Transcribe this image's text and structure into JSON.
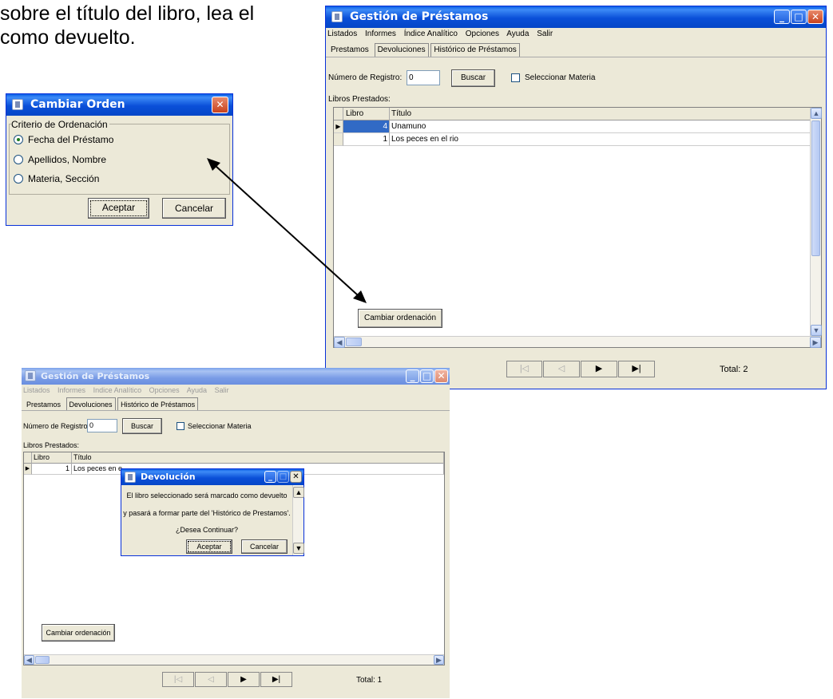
{
  "doc": {
    "line1": "sobre el título del libro, lea el",
    "line2": "como devuelto."
  },
  "main_window": {
    "title": "Gestión de Préstamos",
    "menu": [
      "Listados",
      "Informes",
      "Índice Analítico",
      "Opciones",
      "Ayuda",
      "Salir"
    ],
    "tabs": [
      "Prestamos",
      "Devoluciones",
      "Histórico de Préstamos"
    ],
    "active_tab": "Devoluciones",
    "registro_label": "Número de Registro:",
    "registro_value": "0",
    "buscar_label": "Buscar",
    "materia_label": "Seleccionar Materia",
    "libros_label": "Libros Prestados:",
    "columns": [
      "Libro",
      "Título"
    ],
    "rows": [
      {
        "libro": "4",
        "titulo": "Unamuno"
      },
      {
        "libro": "1",
        "titulo": "Los peces en el rio"
      }
    ],
    "cambiar_label": "Cambiar ordenación",
    "nav": [
      "|◁",
      "◁",
      "▶",
      "▶|"
    ],
    "total": "Total: 2"
  },
  "order_dialog": {
    "title": "Cambiar Orden",
    "group_label": "Criterio de Ordenación",
    "options": [
      "Fecha del Préstamo",
      "Apellidos, Nombre",
      "Materia, Sección"
    ],
    "selected": "Fecha del Préstamo",
    "accept": "Aceptar",
    "cancel": "Cancelar"
  },
  "second_window": {
    "title": "Gestión de Préstamos",
    "menu": [
      "Listados",
      "Informes",
      "Indice Analítico",
      "Opciones",
      "Ayuda",
      "Salir"
    ],
    "tabs": [
      "Prestamos",
      "Devoluciones",
      "Histórico de Préstamos"
    ],
    "registro_label": "Número de Registro:",
    "registro_value": "0",
    "buscar_label": "Buscar",
    "materia_label": "Seleccionar Materia",
    "libros_label": "Libros Prestados:",
    "columns": [
      "Libro",
      "Título"
    ],
    "rows": [
      {
        "libro": "1",
        "titulo": "Los peces en e"
      }
    ],
    "cambiar_label": "Cambiar ordenación",
    "nav": [
      "|◁",
      "◁",
      "▶",
      "▶|"
    ],
    "total": "Total: 1"
  },
  "return_dialog": {
    "title": "Devolución",
    "line1": "El libro seleccionado será marcado como devuelto",
    "line2": "y pasará a formar parte del 'Histórico de Prestamos'.",
    "line3": "¿Desea Continuar?",
    "accept": "Aceptar",
    "cancel": "Cancelar"
  },
  "colors": {
    "title_active": "#0a4fd8",
    "title_inactive": "#7a9ce6",
    "selection": "#316ac5",
    "window_bg": "#ece9d8"
  }
}
